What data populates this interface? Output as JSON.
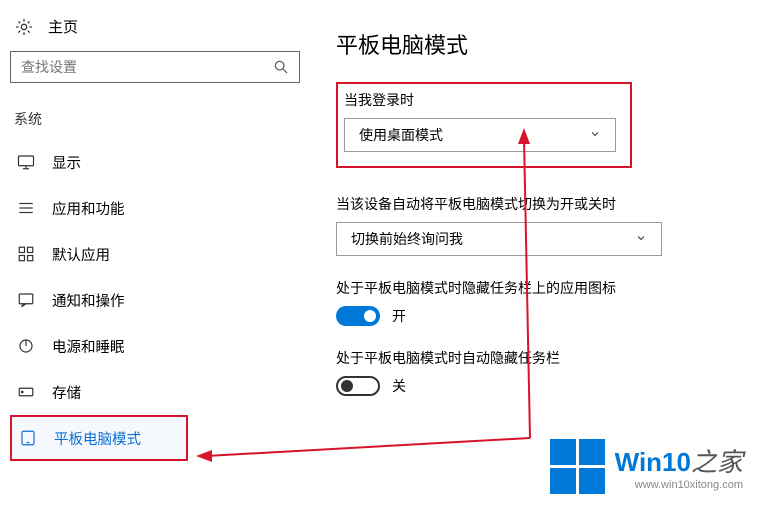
{
  "sidebar": {
    "home_label": "主页",
    "search_placeholder": "查找设置",
    "category": "系统",
    "items": [
      {
        "label": "显示",
        "icon": "display-icon"
      },
      {
        "label": "应用和功能",
        "icon": "apps-icon"
      },
      {
        "label": "默认应用",
        "icon": "default-apps-icon"
      },
      {
        "label": "通知和操作",
        "icon": "notifications-icon"
      },
      {
        "label": "电源和睡眠",
        "icon": "power-icon"
      },
      {
        "label": "存储",
        "icon": "storage-icon"
      },
      {
        "label": "平板电脑模式",
        "icon": "tablet-icon"
      }
    ]
  },
  "main": {
    "title": "平板电脑模式",
    "signin_label": "当我登录时",
    "signin_value": "使用桌面模式",
    "autoswitch_label": "当该设备自动将平板电脑模式切换为开或关时",
    "autoswitch_value": "切换前始终询问我",
    "hide_icons_label": "处于平板电脑模式时隐藏任务栏上的应用图标",
    "hide_icons_state": "开",
    "autohide_tb_label": "处于平板电脑模式时自动隐藏任务栏",
    "autohide_tb_state": "关"
  },
  "watermark": {
    "brand_prefix": "Win10",
    "brand_suffix": "之家",
    "url": "www.win10xitong.com"
  }
}
